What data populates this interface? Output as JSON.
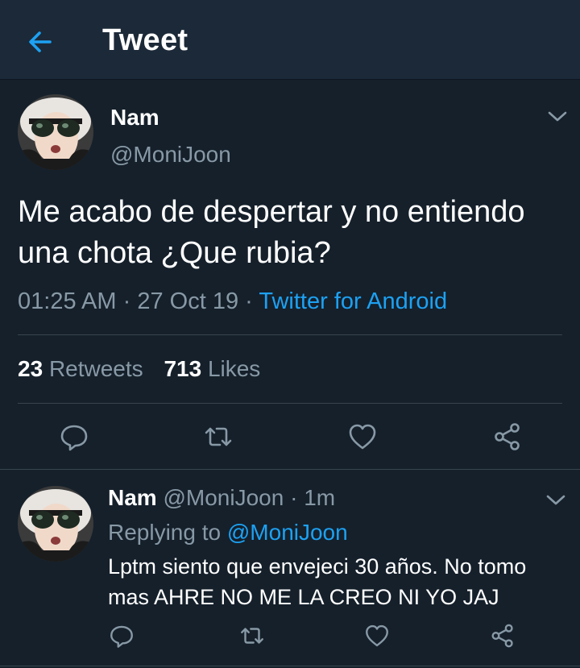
{
  "header": {
    "title": "Tweet",
    "back_icon": "arrow-left-icon",
    "accent": "#1da1f2"
  },
  "main_tweet": {
    "author_name": "Nam",
    "author_handle": "@MoniJoon",
    "text": "Me acabo de despertar y no entiendo una chota ¿Que rubia?",
    "time": "01:25 AM",
    "date": "27 Oct 19",
    "source": "Twitter for Android",
    "retweets_count": "23",
    "retweets_label": "Retweets",
    "likes_count": "713",
    "likes_label": "Likes",
    "actions": [
      "reply-icon",
      "retweet-icon",
      "like-icon",
      "share-icon"
    ]
  },
  "reply_tweet": {
    "author_name": "Nam",
    "author_handle": "@MoniJoon",
    "time_ago": "1m",
    "replying_prefix": "Replying to",
    "replying_to": "@MoniJoon",
    "text": "Lptm siento que envejeci 30 años. No tomo mas AHRE NO ME LA CREO NI YO JAJ",
    "actions": [
      "reply-icon",
      "retweet-icon",
      "like-icon",
      "share-icon"
    ]
  },
  "colors": {
    "background": "#15202b",
    "header_bg": "#1c2938",
    "muted": "#8899a6",
    "divider": "#38444d"
  }
}
